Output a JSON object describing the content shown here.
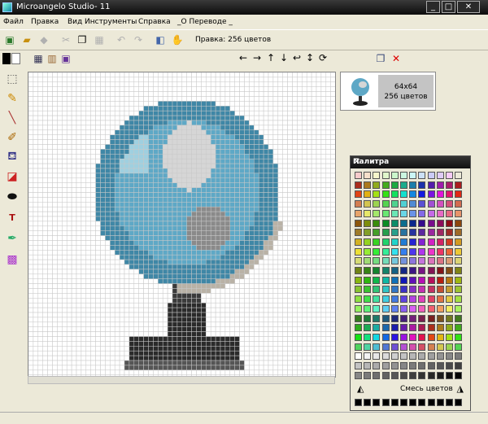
{
  "window": {
    "title": "Microangelo Studio- 11",
    "icon": "app-icon",
    "minimize_icon": "minimize-icon",
    "maximize_icon": "maximize-icon",
    "close_icon": "close-icon"
  },
  "menu": {
    "items": [
      "Файл",
      "Правка",
      "Вид",
      "Инструменты",
      "Справка",
      "_О Переводе _"
    ]
  },
  "toolbar": {
    "status_label": "Правка: 256 цветов",
    "icons": [
      "new-icon",
      "open-icon",
      "save-icon",
      "cut-icon",
      "copy-icon",
      "paste-icon",
      "undo-icon",
      "redo-icon",
      "resource-icon",
      "test-icon"
    ]
  },
  "transform_toolbar": {
    "icons": [
      "shift-left-icon",
      "shift-right-icon",
      "shift-up-icon",
      "shift-down-icon",
      "rotate-left-icon",
      "flip-icon",
      "rotate-right-icon"
    ]
  },
  "tools": {
    "icons": [
      "selection-icon",
      "pencil-icon",
      "line-icon",
      "brush-icon",
      "fill-icon",
      "gradient-icon",
      "ellipse-icon",
      "text-icon",
      "eyedropper-icon",
      "replace-color-icon"
    ]
  },
  "preview": {
    "size_label": "64x64",
    "colors_label": "256 цветов"
  },
  "palette": {
    "title": "Палитра",
    "close_icon": "close-icon",
    "blend_label": "Смесь цветов"
  },
  "colors": {
    "titlebar": "#1a1a1a",
    "globe_ocean": "#5ea8c6",
    "globe_land": "#d6d6d6",
    "stand": "#2a2a2a"
  }
}
